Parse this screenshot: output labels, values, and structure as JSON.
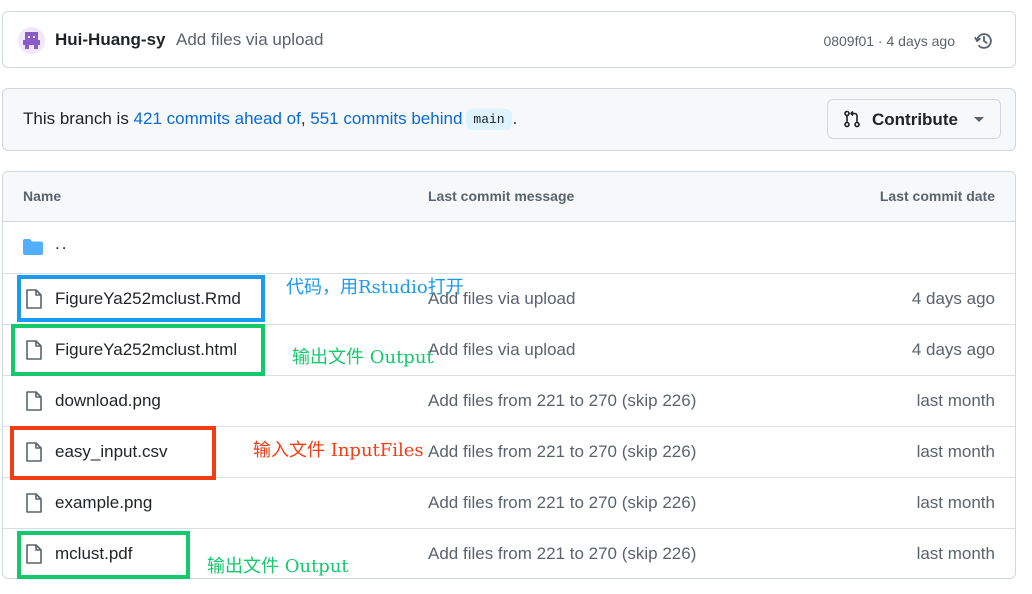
{
  "commit_bar": {
    "author": "Hui-Huang-sy",
    "message": "Add files via upload",
    "sha": "0809f01",
    "time": "4 days ago",
    "icons": {
      "avatar": "identicon-avatar",
      "history": "history-icon"
    }
  },
  "branch_bar": {
    "prefix": "This branch is ",
    "ahead": "421 commits ahead of",
    "sep": ", ",
    "behind": "551 commits behind",
    "branch": "main",
    "suffix": ".",
    "contribute_label": "Contribute"
  },
  "table": {
    "headers": {
      "name": "Name",
      "message": "Last commit message",
      "date": "Last commit date"
    },
    "parent": "..",
    "files": [
      {
        "name": "FigureYa252mclust.Rmd",
        "message": "Add files via upload",
        "date": "4 days ago"
      },
      {
        "name": "FigureYa252mclust.html",
        "message": "Add files via upload",
        "date": "4 days ago"
      },
      {
        "name": "download.png",
        "message": "Add files from 221 to 270 (skip 226)",
        "date": "last month"
      },
      {
        "name": "easy_input.csv",
        "message": "Add files from 221 to 270 (skip 226)",
        "date": "last month"
      },
      {
        "name": "example.png",
        "message": "Add files from 221 to 270 (skip 226)",
        "date": "last month"
      },
      {
        "name": "mclust.pdf",
        "message": "Add files from 221 to 270 (skip 226)",
        "date": "last month"
      }
    ]
  },
  "annotations": {
    "code": "代码，用Rstudio打开",
    "output1": "输出文件 Output",
    "input": "输入文件 InputFiles",
    "output2": "输出文件 Output"
  },
  "colors": {
    "link": "#0969da",
    "annotation_blue": "#1a9bf0",
    "annotation_green": "#13c96b",
    "annotation_red": "#f23c14",
    "folder": "#54aeff"
  }
}
